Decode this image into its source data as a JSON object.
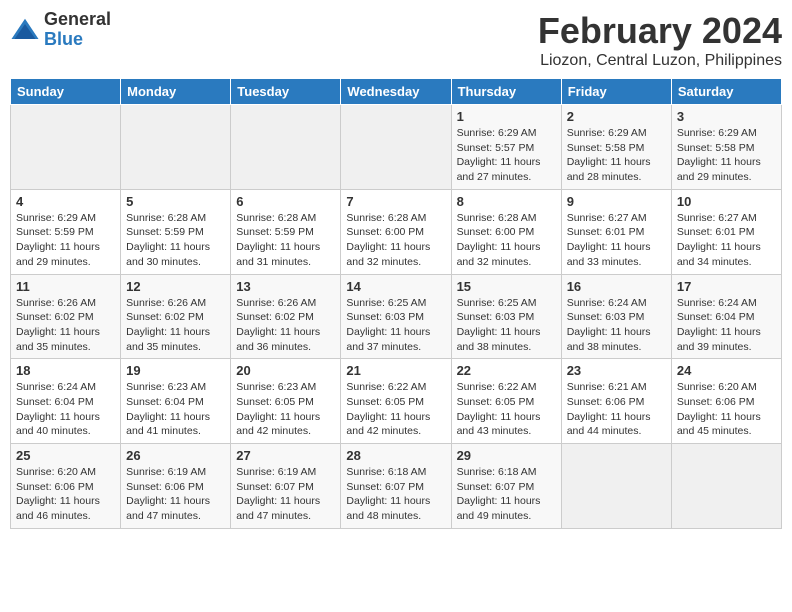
{
  "logo": {
    "general": "General",
    "blue": "Blue"
  },
  "title": "February 2024",
  "location": "Liozon, Central Luzon, Philippines",
  "days_header": [
    "Sunday",
    "Monday",
    "Tuesday",
    "Wednesday",
    "Thursday",
    "Friday",
    "Saturday"
  ],
  "weeks": [
    [
      {
        "day": "",
        "info": ""
      },
      {
        "day": "",
        "info": ""
      },
      {
        "day": "",
        "info": ""
      },
      {
        "day": "",
        "info": ""
      },
      {
        "day": "1",
        "info": "Sunrise: 6:29 AM\nSunset: 5:57 PM\nDaylight: 11 hours\nand 27 minutes."
      },
      {
        "day": "2",
        "info": "Sunrise: 6:29 AM\nSunset: 5:58 PM\nDaylight: 11 hours\nand 28 minutes."
      },
      {
        "day": "3",
        "info": "Sunrise: 6:29 AM\nSunset: 5:58 PM\nDaylight: 11 hours\nand 29 minutes."
      }
    ],
    [
      {
        "day": "4",
        "info": "Sunrise: 6:29 AM\nSunset: 5:59 PM\nDaylight: 11 hours\nand 29 minutes."
      },
      {
        "day": "5",
        "info": "Sunrise: 6:28 AM\nSunset: 5:59 PM\nDaylight: 11 hours\nand 30 minutes."
      },
      {
        "day": "6",
        "info": "Sunrise: 6:28 AM\nSunset: 5:59 PM\nDaylight: 11 hours\nand 31 minutes."
      },
      {
        "day": "7",
        "info": "Sunrise: 6:28 AM\nSunset: 6:00 PM\nDaylight: 11 hours\nand 32 minutes."
      },
      {
        "day": "8",
        "info": "Sunrise: 6:28 AM\nSunset: 6:00 PM\nDaylight: 11 hours\nand 32 minutes."
      },
      {
        "day": "9",
        "info": "Sunrise: 6:27 AM\nSunset: 6:01 PM\nDaylight: 11 hours\nand 33 minutes."
      },
      {
        "day": "10",
        "info": "Sunrise: 6:27 AM\nSunset: 6:01 PM\nDaylight: 11 hours\nand 34 minutes."
      }
    ],
    [
      {
        "day": "11",
        "info": "Sunrise: 6:26 AM\nSunset: 6:02 PM\nDaylight: 11 hours\nand 35 minutes."
      },
      {
        "day": "12",
        "info": "Sunrise: 6:26 AM\nSunset: 6:02 PM\nDaylight: 11 hours\nand 35 minutes."
      },
      {
        "day": "13",
        "info": "Sunrise: 6:26 AM\nSunset: 6:02 PM\nDaylight: 11 hours\nand 36 minutes."
      },
      {
        "day": "14",
        "info": "Sunrise: 6:25 AM\nSunset: 6:03 PM\nDaylight: 11 hours\nand 37 minutes."
      },
      {
        "day": "15",
        "info": "Sunrise: 6:25 AM\nSunset: 6:03 PM\nDaylight: 11 hours\nand 38 minutes."
      },
      {
        "day": "16",
        "info": "Sunrise: 6:24 AM\nSunset: 6:03 PM\nDaylight: 11 hours\nand 38 minutes."
      },
      {
        "day": "17",
        "info": "Sunrise: 6:24 AM\nSunset: 6:04 PM\nDaylight: 11 hours\nand 39 minutes."
      }
    ],
    [
      {
        "day": "18",
        "info": "Sunrise: 6:24 AM\nSunset: 6:04 PM\nDaylight: 11 hours\nand 40 minutes."
      },
      {
        "day": "19",
        "info": "Sunrise: 6:23 AM\nSunset: 6:04 PM\nDaylight: 11 hours\nand 41 minutes."
      },
      {
        "day": "20",
        "info": "Sunrise: 6:23 AM\nSunset: 6:05 PM\nDaylight: 11 hours\nand 42 minutes."
      },
      {
        "day": "21",
        "info": "Sunrise: 6:22 AM\nSunset: 6:05 PM\nDaylight: 11 hours\nand 42 minutes."
      },
      {
        "day": "22",
        "info": "Sunrise: 6:22 AM\nSunset: 6:05 PM\nDaylight: 11 hours\nand 43 minutes."
      },
      {
        "day": "23",
        "info": "Sunrise: 6:21 AM\nSunset: 6:06 PM\nDaylight: 11 hours\nand 44 minutes."
      },
      {
        "day": "24",
        "info": "Sunrise: 6:20 AM\nSunset: 6:06 PM\nDaylight: 11 hours\nand 45 minutes."
      }
    ],
    [
      {
        "day": "25",
        "info": "Sunrise: 6:20 AM\nSunset: 6:06 PM\nDaylight: 11 hours\nand 46 minutes."
      },
      {
        "day": "26",
        "info": "Sunrise: 6:19 AM\nSunset: 6:06 PM\nDaylight: 11 hours\nand 47 minutes."
      },
      {
        "day": "27",
        "info": "Sunrise: 6:19 AM\nSunset: 6:07 PM\nDaylight: 11 hours\nand 47 minutes."
      },
      {
        "day": "28",
        "info": "Sunrise: 6:18 AM\nSunset: 6:07 PM\nDaylight: 11 hours\nand 48 minutes."
      },
      {
        "day": "29",
        "info": "Sunrise: 6:18 AM\nSunset: 6:07 PM\nDaylight: 11 hours\nand 49 minutes."
      },
      {
        "day": "",
        "info": ""
      },
      {
        "day": "",
        "info": ""
      }
    ]
  ]
}
